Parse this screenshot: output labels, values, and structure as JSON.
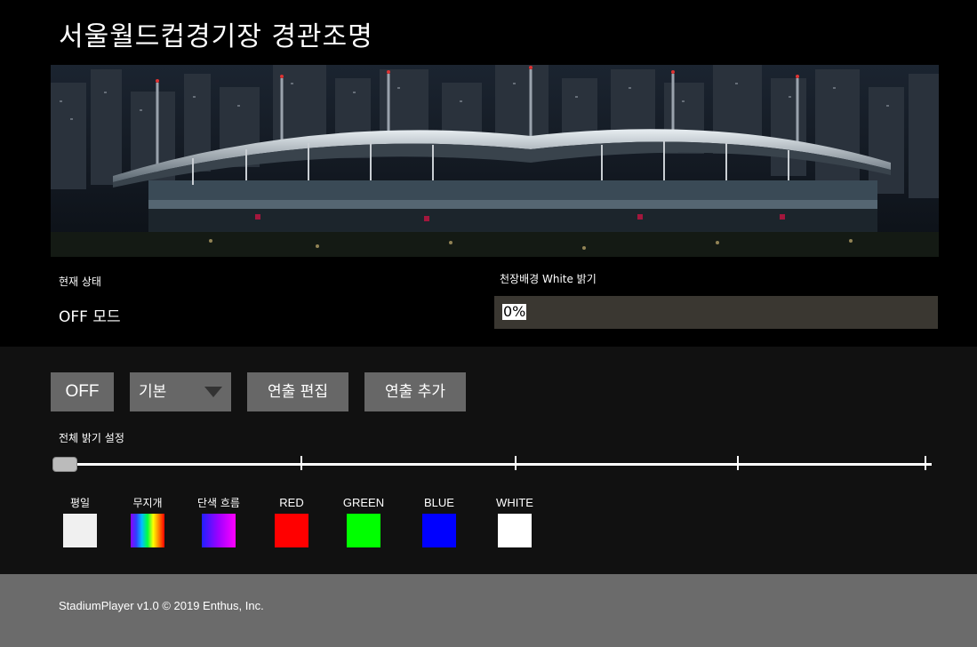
{
  "title": "서울월드컵경기장 경관조명",
  "status": {
    "label": "현재 상태",
    "value": "OFF 모드"
  },
  "ceiling_brightness": {
    "label": "천장배경 White 밝기",
    "value": "0%"
  },
  "toolbar": {
    "off_label": "OFF",
    "mode_select": "기본",
    "edit_label": "연출 편집",
    "add_label": "연출 추가"
  },
  "master_brightness": {
    "label": "전체 밝기 설정",
    "value_fraction": 0
  },
  "presets": [
    {
      "label": "평일",
      "fill": "#f0f0f0"
    },
    {
      "label": "무지개",
      "fill": "rainbow"
    },
    {
      "label": "단색 흐름",
      "fill": "gradient-blue-magenta"
    },
    {
      "label": "RED",
      "fill": "#ff0000"
    },
    {
      "label": "GREEN",
      "fill": "#00ff00"
    },
    {
      "label": "BLUE",
      "fill": "#0000ff"
    },
    {
      "label": "WHITE",
      "fill": "#ffffff"
    }
  ],
  "footer": {
    "text": "StadiumPlayer v1.0 © 2019 Enthus, Inc."
  },
  "colors": {
    "button_bg": "#676767",
    "panel_bg": "#111111",
    "field_bg": "#3a3731",
    "footer_bg": "#6b6b6b"
  }
}
